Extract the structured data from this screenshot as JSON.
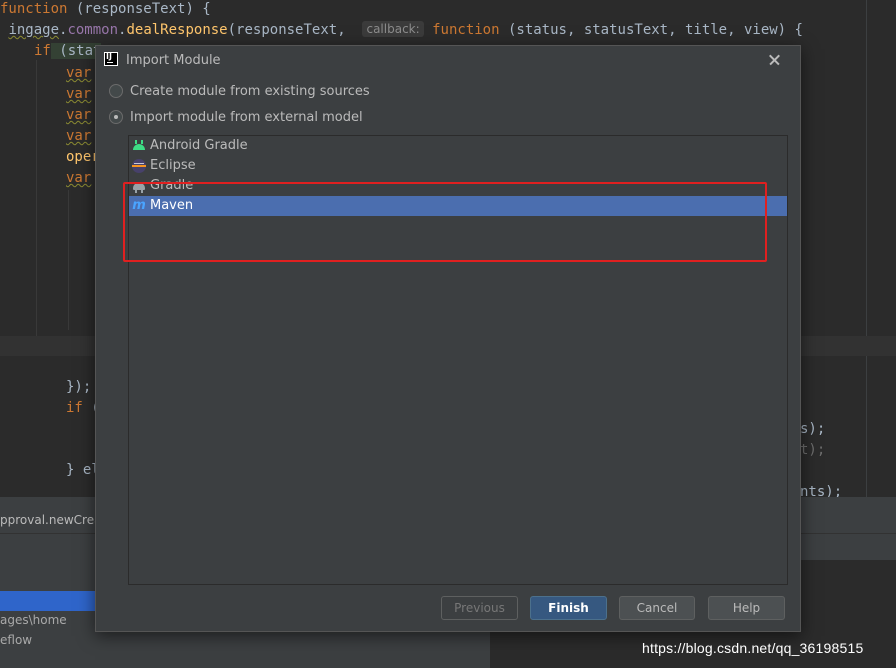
{
  "editor": {
    "line1": {
      "kw": "function",
      "rest": " (responseText) {"
    },
    "line2": {
      "pre": " ",
      "obj": "ingage",
      "dot1": ".",
      "obj2": "common",
      "dot2": ".",
      "fn": "dealResponse",
      "args": "(responseText,  ",
      "hint": "callback:",
      "kw": " function",
      "rest": " (status, statusText, title, view) {"
    },
    "line3": {
      "kw": "if",
      "rest": " (stat"
    },
    "var_kw": "var",
    "oper": "oper",
    "close_brace": "});",
    "if_kw": "if",
    "if_rest": " (",
    "else": "} el",
    "right1": "s);",
    "right2": "t);",
    "right3": "nts);"
  },
  "breadcrumb": "pproval.newCrea",
  "tree": {
    "item1": "ages\\home",
    "item2": "eflow"
  },
  "dialog": {
    "title": "Import Module",
    "options": [
      {
        "label": "Create module from existing sources",
        "checked": false
      },
      {
        "label": "Import module from external model",
        "checked": true
      }
    ],
    "models": [
      {
        "label": "Android Gradle",
        "icon": "android-icon"
      },
      {
        "label": "Eclipse",
        "icon": "eclipse-icon"
      },
      {
        "label": "Gradle",
        "icon": "gradle-icon"
      },
      {
        "label": "Maven",
        "icon": "maven-icon",
        "glyph": "m",
        "selected": true
      }
    ],
    "buttons": {
      "previous": "Previous",
      "finish": "Finish",
      "cancel": "Cancel",
      "help": "Help"
    }
  },
  "annotation": {
    "color": "#e02020"
  },
  "watermark": "https://blog.csdn.net/qq_36198515",
  "colors": {
    "selection": "#4b6eaf",
    "default_button": "#365880",
    "keyword": "#cc7832",
    "function": "#ffc66d"
  }
}
